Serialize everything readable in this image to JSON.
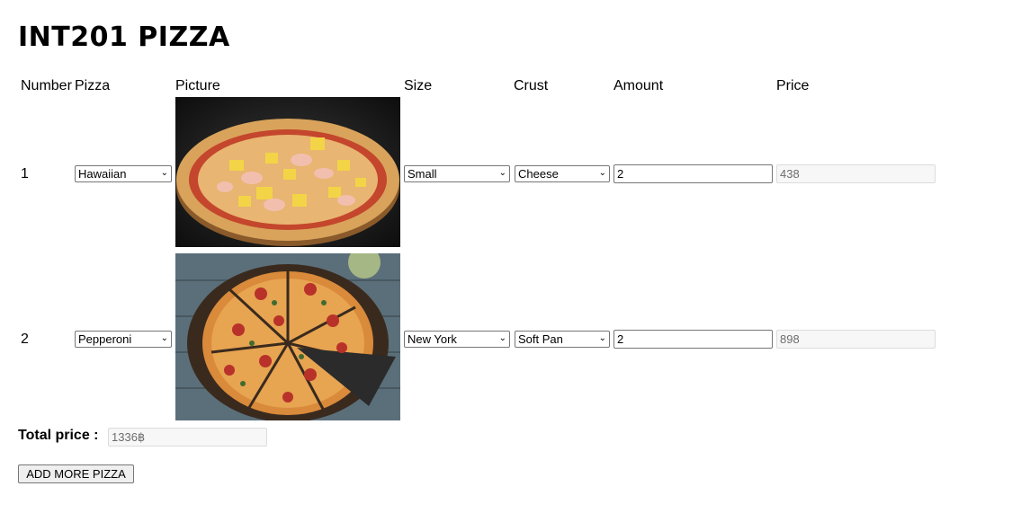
{
  "page": {
    "title": "INT201 PIZZA"
  },
  "table": {
    "headers": {
      "number": "Number",
      "pizza": "Pizza",
      "picture": "Picture",
      "size": "Size",
      "crust": "Crust",
      "amount": "Amount",
      "price": "Price"
    },
    "rows": [
      {
        "number": "1",
        "pizza": "Hawaiian",
        "picture": "hawaiian-pizza-photo",
        "size": "Small",
        "crust": "Cheese",
        "amount": "2",
        "price": "438"
      },
      {
        "number": "2",
        "pizza": "Pepperoni",
        "picture": "pepperoni-pizza-photo",
        "size": "New York",
        "crust": "Soft Pan",
        "amount": "2",
        "price": "898"
      }
    ]
  },
  "total": {
    "label": "Total price :",
    "value": "1336฿"
  },
  "actions": {
    "add_more": "ADD MORE PIZZA"
  },
  "icons": {
    "dropdown": "chevron-down-icon"
  }
}
